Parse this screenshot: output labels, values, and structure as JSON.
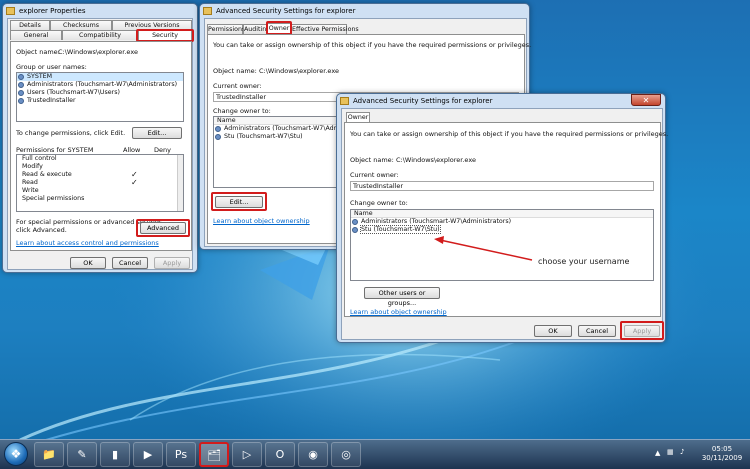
{
  "w1": {
    "title": "explorer Properties",
    "tabs_row1": [
      "Details",
      "Checksums",
      "Previous Versions"
    ],
    "tabs_row2": [
      "General",
      "Compatibility",
      "Security"
    ],
    "object_name_label": "Object name:",
    "object_name_value": "C:\\Windows\\explorer.exe",
    "group_label": "Group or user names:",
    "groups": [
      "SYSTEM",
      "Administrators (Touchsmart-W7\\Administrators)",
      "Users (Touchsmart-W7\\Users)",
      "TrustedInstaller"
    ],
    "change_perm_text": "To change permissions, click Edit.",
    "edit_btn": "Edit...",
    "perm_for": "Permissions for SYSTEM",
    "allow": "Allow",
    "deny": "Deny",
    "permissions": [
      "Full control",
      "Modify",
      "Read & execute",
      "Read",
      "Write",
      "Special permissions"
    ],
    "allowed": [
      false,
      false,
      true,
      true,
      false,
      false
    ],
    "special_text_1": "For special permissions or advanced settings,",
    "special_text_2": "click Advanced.",
    "advanced_btn": "Advanced",
    "learn_link": "Learn about access control and permissions",
    "ok": "OK",
    "cancel": "Cancel",
    "apply": "Apply"
  },
  "w2": {
    "title": "Advanced Security Settings for explorer",
    "tabs": [
      "Permissions",
      "Auditing",
      "Owner",
      "Effective Permissions"
    ],
    "intro": "You can take or assign ownership of this object if you have the required permissions or privileges.",
    "object_name_label": "Object name:",
    "object_name_value": "C:\\Windows\\explorer.exe",
    "current_owner_label": "Current owner:",
    "current_owner_value": "TrustedInstaller",
    "change_owner_label": "Change owner to:",
    "name_header": "Name",
    "owners": [
      "Administrators (Touchsmart-W7\\Administrat",
      "Stu (Touchsmart-W7\\Stu)"
    ],
    "edit_btn": "Edit...",
    "learn_link": "Learn about object ownership"
  },
  "w3": {
    "title": "Advanced Security Settings for explorer",
    "tab": "Owner",
    "intro": "You can take or assign ownership of this object if you have the required permissions or privileges.",
    "object_name_label": "Object name:",
    "object_name_value": "C:\\Windows\\explorer.exe",
    "current_owner_label": "Current owner:",
    "current_owner_value": "TrustedInstaller",
    "change_owner_label": "Change owner to:",
    "name_header": "Name",
    "owners": [
      "Administrators (Touchsmart-W7\\Administrators)",
      "Stu (Touchsmart-W7\\Stu)"
    ],
    "annotation": "choose your username",
    "other_users_btn": "Other users or groups...",
    "learn_link": "Learn about object ownership",
    "ok": "OK",
    "cancel": "Cancel",
    "apply": "Apply"
  },
  "taskbar": {
    "items": [
      {
        "name": "folder-icon",
        "glyph": "📁"
      },
      {
        "name": "notepad-icon",
        "glyph": "✎"
      },
      {
        "name": "cmd-icon",
        "glyph": "▮"
      },
      {
        "name": "media-player-icon",
        "glyph": "▶"
      },
      {
        "name": "photoshop-icon",
        "glyph": "Ps"
      },
      {
        "name": "explorer-icon",
        "glyph": "🗂"
      },
      {
        "name": "media-center-icon",
        "glyph": "▷"
      },
      {
        "name": "outlook-icon",
        "glyph": "O"
      },
      {
        "name": "firefox-icon",
        "glyph": "◉"
      },
      {
        "name": "chrome-icon",
        "glyph": "◎"
      }
    ],
    "time": "05:05",
    "date": "30/11/2009"
  }
}
